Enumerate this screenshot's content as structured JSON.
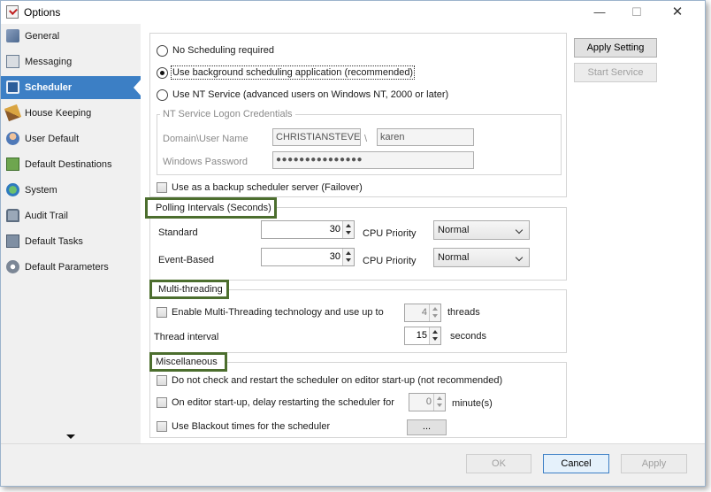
{
  "window": {
    "title": "Options",
    "min_glyph": "—",
    "max_glyph": "☐",
    "close_glyph": "✕"
  },
  "sidebar": {
    "items": [
      {
        "label": "General",
        "icon": "general-icon"
      },
      {
        "label": "Messaging",
        "icon": "messaging-icon"
      },
      {
        "label": "Scheduler",
        "icon": "scheduler-icon",
        "active": true
      },
      {
        "label": "House Keeping",
        "icon": "broom-icon"
      },
      {
        "label": "User Default",
        "icon": "users-icon"
      },
      {
        "label": "Default Destinations",
        "icon": "destinations-icon"
      },
      {
        "label": "System",
        "icon": "globe-icon"
      },
      {
        "label": "Audit Trail",
        "icon": "audit-trail-icon"
      },
      {
        "label": "Default Tasks",
        "icon": "tasks-icon"
      },
      {
        "label": "Default Parameters",
        "icon": "gear-icon"
      }
    ],
    "active_color": "#3c7fc5"
  },
  "scheduling": {
    "options": [
      {
        "label": "No Scheduling required",
        "checked": false
      },
      {
        "label": "Use background scheduling application (recommended)",
        "checked": true
      },
      {
        "label": "Use NT Service (advanced users on Windows NT, 2000 or later)",
        "checked": false
      }
    ],
    "nt_service": {
      "group_title": "NT Service Logon Credentials",
      "domain_label": "Domain\\User Name",
      "domain_value": "CHRISTIANSTEVEN",
      "separator": "\\",
      "user_value": "karen",
      "password_label": "Windows Password",
      "password_value": "●●●●●●●●●●●●●●●"
    },
    "backup_label": "Use as a backup scheduler server (Failover)"
  },
  "actions": {
    "apply_setting": "Apply Setting",
    "start_service": "Start Service"
  },
  "polling": {
    "title": "Polling Intervals (Seconds)",
    "standard_label": "Standard",
    "standard_value": "30",
    "standard_priority_label": "CPU Priority",
    "standard_priority": "Normal",
    "event_label": "Event-Based",
    "event_value": "30",
    "event_priority_label": "CPU Priority",
    "event_priority": "Normal"
  },
  "multithreading": {
    "title": "Multi-threading",
    "enable_label": "Enable Multi-Threading technology and use up to",
    "threads_value": "4",
    "threads_unit": "threads",
    "interval_label": "Thread interval",
    "interval_value": "15",
    "interval_unit": "seconds"
  },
  "misc": {
    "title": "Miscellaneous",
    "no_restart_label": "Do not check and restart the scheduler on editor start-up (not recommended)",
    "delay_label": "On editor start-up, delay restarting the scheduler for",
    "delay_value": "0",
    "delay_unit": "minute(s)",
    "blackout_label": "Use Blackout times for the scheduler",
    "blackout_button": "..."
  },
  "footer": {
    "ok": "OK",
    "cancel": "Cancel",
    "apply": "Apply"
  },
  "highlight_color": "#4c6e2e"
}
